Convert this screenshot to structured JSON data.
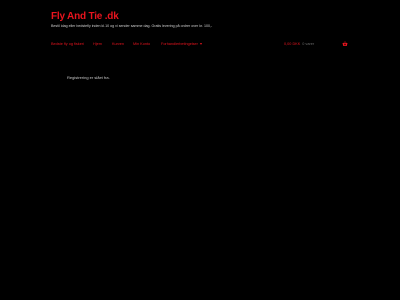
{
  "header": {
    "site_title": "Fly And Tie .dk",
    "tagline": "Bestil idag eller bedstefly inden kl.10 og vi sender samme dag. Gratis levering på ordrer over kr. 100,-"
  },
  "nav": {
    "items": [
      {
        "label": "Bedste fly og fiskeri"
      },
      {
        "label": "Hjem"
      },
      {
        "label": "Kurven"
      },
      {
        "label": "Min Konto"
      },
      {
        "label": "Forhandlerbetingelser"
      }
    ]
  },
  "cart": {
    "total": "0,00 DKK",
    "items": "0 varer"
  },
  "main": {
    "message": "Registrering er slået fra."
  },
  "colors": {
    "accent": "#e8141e",
    "background": "#000000",
    "text": "#c9c9c9"
  },
  "icons": {
    "cart": "shopping-basket-icon",
    "dropdown": "chevron-down-icon"
  }
}
